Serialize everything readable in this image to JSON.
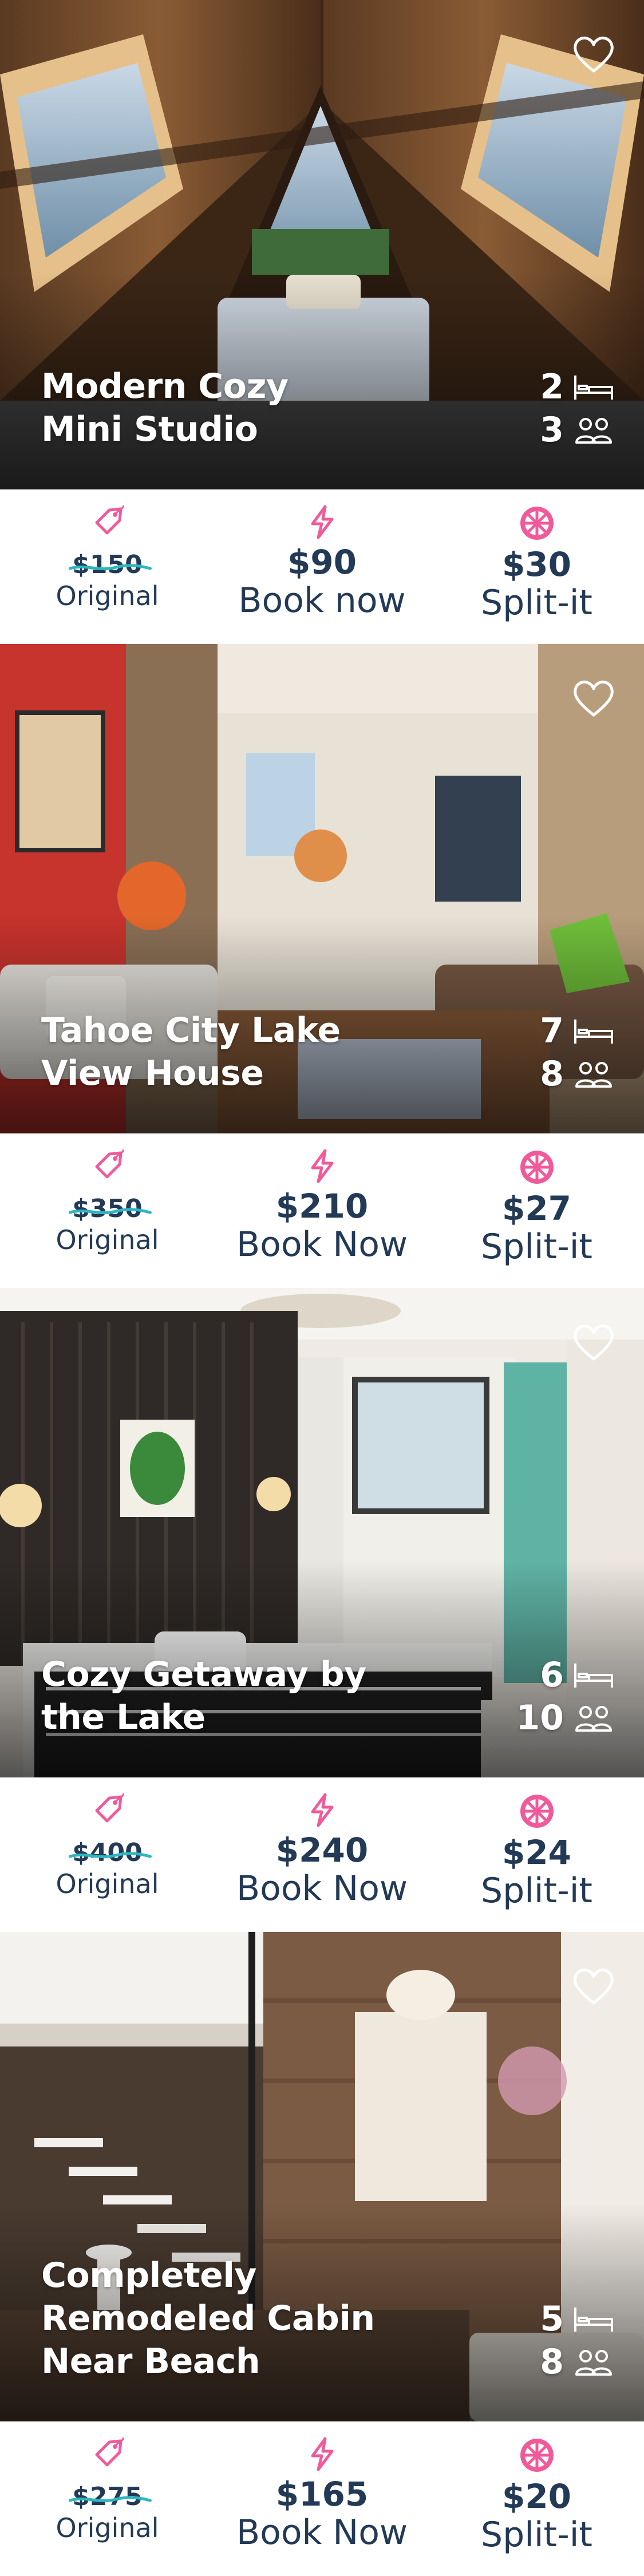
{
  "colors": {
    "accent_pink": "#f05a9a",
    "accent_teal": "#2bb7c2",
    "text_navy": "#233a56"
  },
  "icons": {
    "favorite": "heart-icon",
    "beds": "bed-icon",
    "guests": "people-icon",
    "original": "price-tag-icon",
    "book": "lightning-icon",
    "split": "citrus-slice-icon"
  },
  "listings": [
    {
      "title_lines": [
        "Modern Cozy",
        "Mini Studio"
      ],
      "beds": "2",
      "guests": "3",
      "original_price": "$150",
      "original_label": "Original",
      "book_price": "$90",
      "book_label": "Book now",
      "split_price": "$30",
      "split_label": "Split-it"
    },
    {
      "title_lines": [
        "Tahoe City Lake",
        "View House"
      ],
      "beds": "7",
      "guests": "8",
      "original_price": "$350",
      "original_label": "Original",
      "book_price": "$210",
      "book_label": "Book Now",
      "split_price": "$27",
      "split_label": "Split-it"
    },
    {
      "title_lines": [
        "Cozy Getaway by",
        "the Lake"
      ],
      "beds": "6",
      "guests": "10",
      "original_price": "$400",
      "original_label": "Original",
      "book_price": "$240",
      "book_label": "Book Now",
      "split_price": "$24",
      "split_label": "Split-it"
    },
    {
      "title_lines": [
        "Completely",
        "Remodeled Cabin",
        "Near Beach"
      ],
      "beds": "5",
      "guests": "8",
      "original_price": "$275",
      "original_label": "Original",
      "book_price": "$165",
      "book_label": "Book Now",
      "split_price": "$20",
      "split_label": "Split-it"
    }
  ]
}
